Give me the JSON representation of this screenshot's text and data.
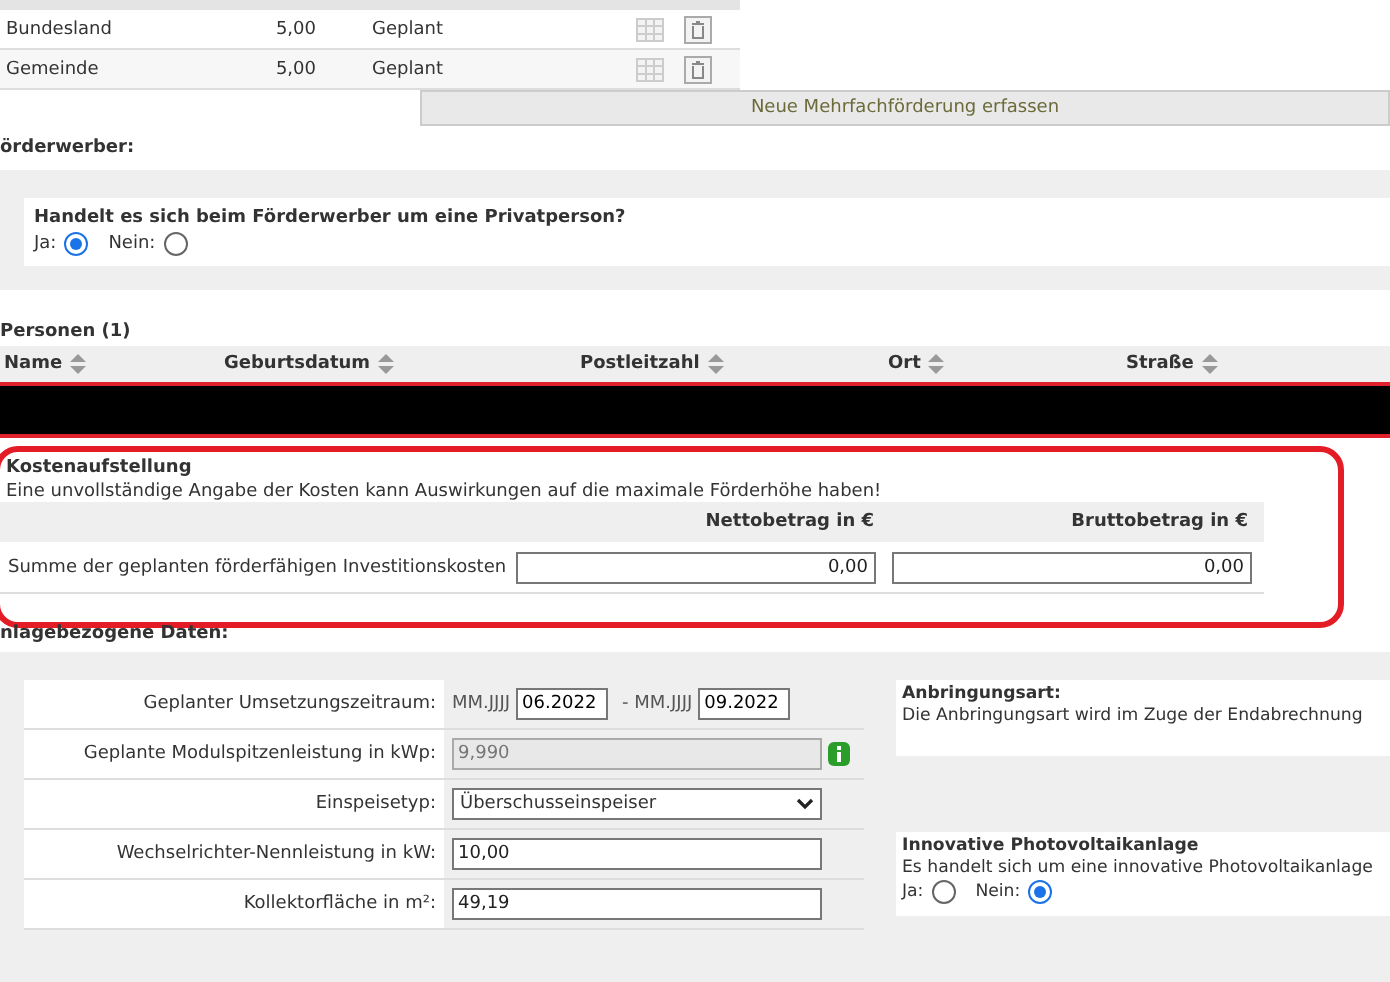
{
  "funding_table": {
    "rows": [
      {
        "name": "Bundesland",
        "amount": "5,00",
        "status": "Geplant"
      },
      {
        "name": "Gemeinde",
        "amount": "5,00",
        "status": "Geplant"
      }
    ],
    "add_button": "Neue Mehrfachförderung erfassen"
  },
  "applicant": {
    "heading": "örderwerber:",
    "question": "Handelt es sich beim Förderwerber um eine Privatperson?",
    "options": [
      {
        "label": "Ja:",
        "selected": true
      },
      {
        "label": "Nein:",
        "selected": false
      }
    ]
  },
  "persons": {
    "heading": "Personen (1)",
    "columns": [
      "Name",
      "Geburtsdatum",
      "Postleitzahl",
      "Ort",
      "Straße"
    ]
  },
  "costs": {
    "title": "Kostenaufstellung",
    "note": "Eine unvollständige Angabe der Kosten kann Auswirkungen auf die maximale Förderhöhe haben!",
    "columns": [
      "Nettobetrag in €",
      "Bruttobetrag in €"
    ],
    "row_label": "Summe der geplanten förderfähigen Investitionskosten",
    "values": [
      "0,00",
      "0,00"
    ]
  },
  "plant_data": {
    "heading": "nlagebezogene Daten:",
    "fields": [
      {
        "kind": "period",
        "label": "Geplanter Umsetzungszeitraum:",
        "from_hint": "MM.JJJJ",
        "from": "06.2022",
        "separator": "- MM.JJJJ",
        "to": "09.2022"
      },
      {
        "kind": "readonly",
        "label": "Geplante Modulspitzenleistung in kWp:",
        "value": "9,990"
      },
      {
        "kind": "select",
        "label": "Einspeisetyp:",
        "value": "Überschusseinspeiser"
      },
      {
        "kind": "text",
        "label": "Wechselrichter-Nennleistung in kW:",
        "value": "10,00"
      },
      {
        "kind": "text",
        "label": "Kollektorfläche in m²:",
        "value": "49,19"
      }
    ],
    "mounting": {
      "title": "Anbringungsart:",
      "text": "Die Anbringungsart wird im Zuge der Endabrechnung"
    },
    "innovative": {
      "title": "Innovative Photovoltaikanlage",
      "text": "Es handelt sich um eine innovative Photovoltaikanlage",
      "options": [
        {
          "label": "Ja:",
          "selected": false
        },
        {
          "label": "Nein:",
          "selected": true
        }
      ]
    }
  }
}
